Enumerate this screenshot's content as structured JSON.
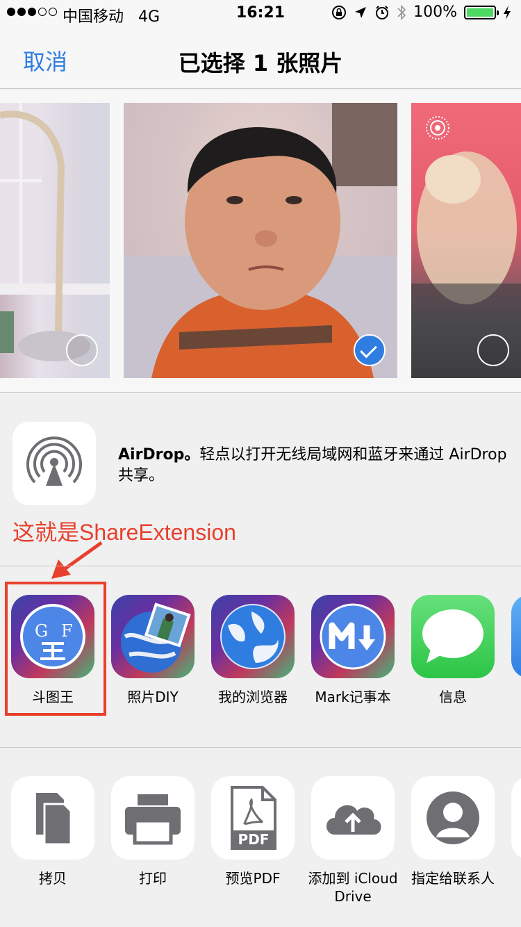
{
  "status_bar": {
    "carrier": "中国移动",
    "network": "4G",
    "time": "16:21",
    "battery": "100%",
    "signal_bars_filled": 3,
    "signal_bars_total": 5
  },
  "nav": {
    "cancel_label": "取消",
    "title": "已选择 1 张照片"
  },
  "photos": [
    {
      "selected": false
    },
    {
      "selected": true
    },
    {
      "selected": false
    }
  ],
  "airdrop": {
    "title": "AirDrop。",
    "description": "轻点以打开无线局域网和蓝牙来通过 AirDrop 共享。"
  },
  "annotation": {
    "text": "这就是ShareExtension",
    "color": "#e8402c"
  },
  "share_apps": [
    {
      "label": "斗图王",
      "icon": "gf-app-icon"
    },
    {
      "label": "照片DIY",
      "icon": "globe-photo-icon"
    },
    {
      "label": "我的浏览器",
      "icon": "globe-icon"
    },
    {
      "label": "Mark记事本",
      "icon": "markdown-icon"
    },
    {
      "label": "信息",
      "icon": "message-bubble-icon"
    }
  ],
  "actions": [
    {
      "label": "拷贝",
      "icon": "copy-icon"
    },
    {
      "label": "打印",
      "icon": "printer-icon"
    },
    {
      "label": "预览PDF",
      "icon": "pdf-icon"
    },
    {
      "label": "添加到 iCloud Drive",
      "icon": "cloud-upload-icon"
    },
    {
      "label": "指定给联系人",
      "icon": "contact-icon"
    }
  ],
  "accent_color": "#2f7de1"
}
